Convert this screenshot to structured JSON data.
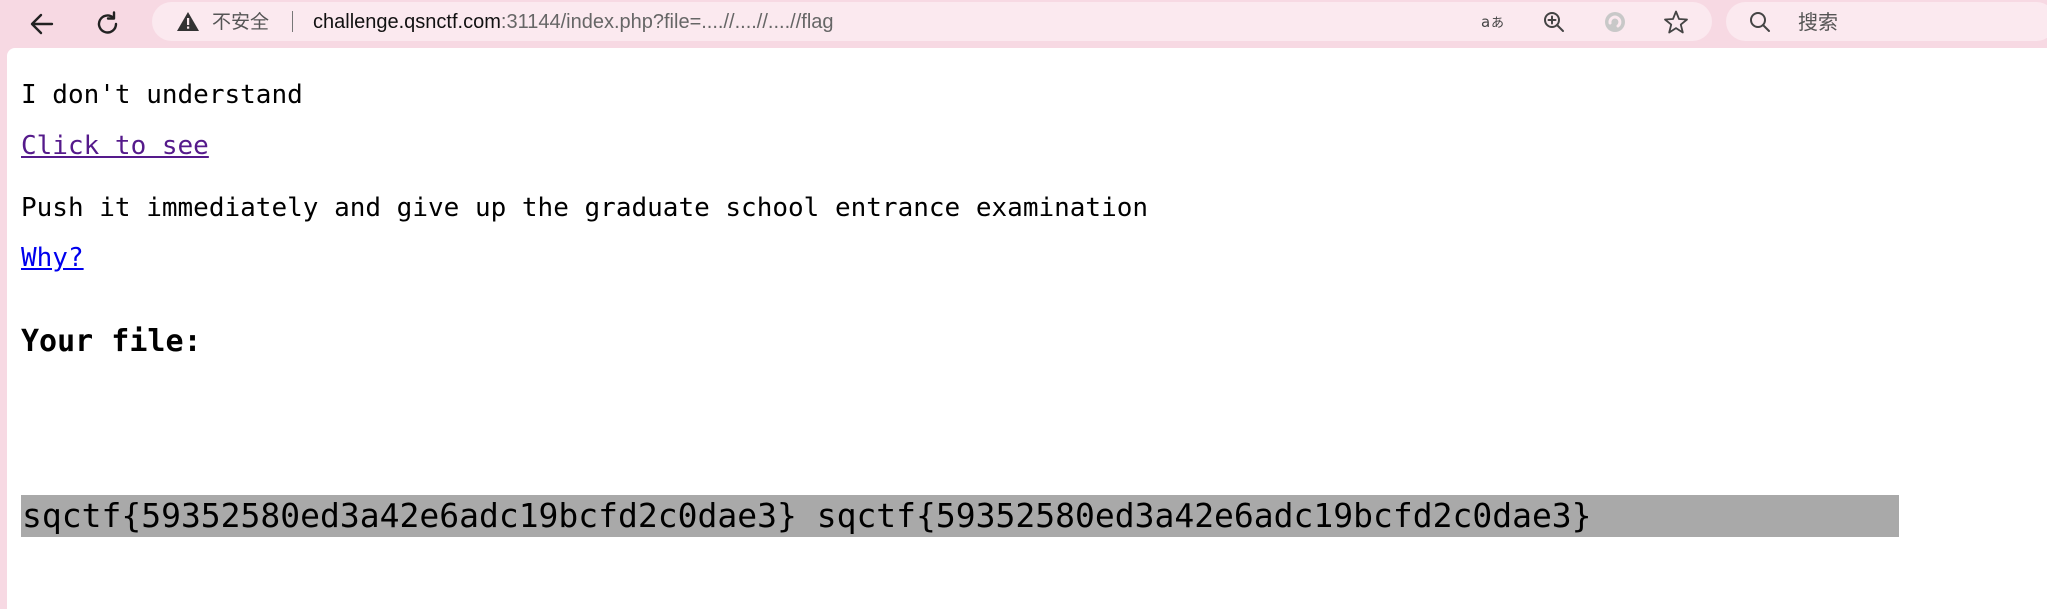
{
  "browser": {
    "security_label": "不安全",
    "url_host": "challenge.qsnctf.com",
    "url_rest": ":31144/index.php?file=....//....//....//flag",
    "search_placeholder": "搜索",
    "icons": [
      "back-arrow-icon",
      "reload-icon",
      "warning-icon",
      "read-aloud-icon",
      "zoom-in-icon",
      "edge-refresh-icon",
      "favorite-star-icon",
      "search-icon"
    ]
  },
  "page": {
    "line_1": "I don't understand",
    "link_1": "Click to see",
    "line_2": "Push it immediately and give up the graduate school entrance examination",
    "link_2": "Why?",
    "file_heading": "Your file:",
    "file_content": "sqctf{59352580ed3a42e6adc19bcfd2c0dae3} sqctf{59352580ed3a42e6adc19bcfd2c0dae3}"
  },
  "colors": {
    "toolbar_bg": "#f7d9e3",
    "visited_link": "#551a8b",
    "link": "#0000ee",
    "highlight_bg": "#a9a9a9"
  }
}
